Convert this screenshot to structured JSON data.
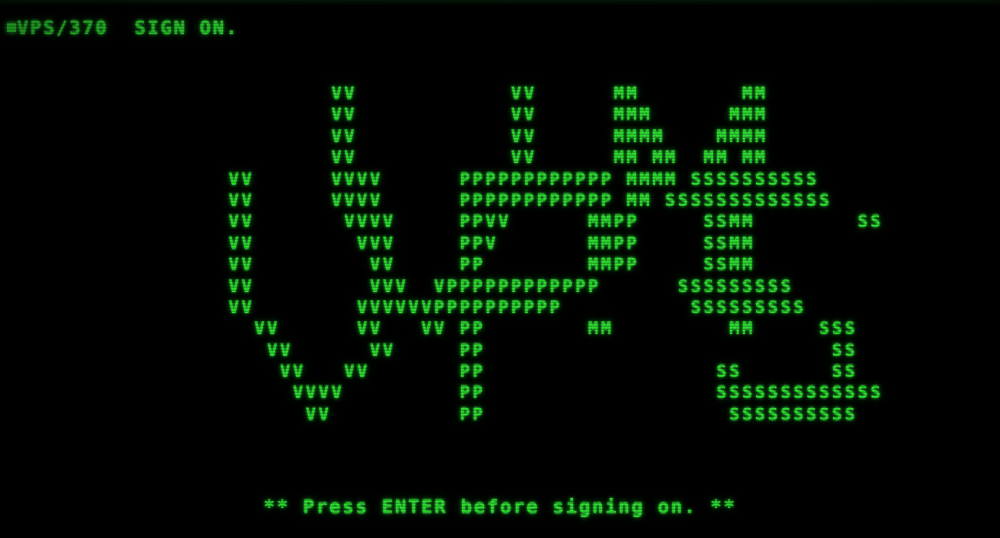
{
  "terminal": {
    "background_color": "#000000",
    "phosphor_color": "#2fe02f",
    "header": {
      "cursor_glyph": "block-cursor",
      "text": "VPS/370  SIGN ON."
    },
    "prompt": {
      "text": "** Press ENTER before signing on. **"
    },
    "banner": {
      "label": "VPS ascii-art logo",
      "rows": [
        "          VV            VV      MM        MM",
        "          VV            VV      MMM      MMM",
        "          VV            VV      MMMM    MMMM",
        "          VV            VV      MM MM  MM MM",
        "  VV      VVVV      PPPPPPPPPPPP MMMM SSSSSSSSSS",
        "  VV      VVVV      PPPPPPPPPPPP MM SSSSSSSSSSSSS",
        "  VV       VVVV     PPVV      MMPP     SSMM        SS",
        "  VV        VVV     PPV       MMPP     SSMM",
        "  VV         VV     PP        MMPP     SSMM",
        "  VV         VVV  VPPPPPPPPPPPP      SSSSSSSSS",
        "  VV        VVVVVVPPPPPPPPPP          SSSSSSSSS",
        "    VV      VV   VV PP        MM         MM     SSS",
        "     VV      VV     PP                           SS",
        "      VV   VV       PP                  SS       SS",
        "       VVVV         PP                  SSSSSSSSSSSSS",
        "        VV          PP                   SSSSSSSSSS"
      ]
    }
  }
}
